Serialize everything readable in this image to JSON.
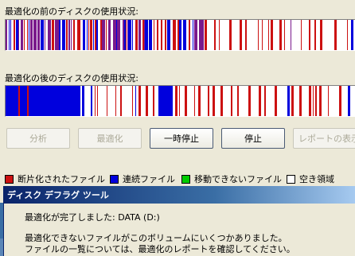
{
  "analysis": {
    "before_label": "最適化の前のディスクの使用状況:",
    "after_label": "最適化の後のディスクの使用状況:"
  },
  "colors": {
    "fragmented": "#cc1111",
    "contiguous": "#0000dd",
    "unmovable": "#00cc00",
    "free": "#ffffff",
    "purple": "#7a1a8c"
  },
  "buttons": {
    "analyze": "分析",
    "defragment": "最適化",
    "pause": "一時停止",
    "stop": "停止",
    "view_report": "レポートの表示"
  },
  "legend": {
    "fragmented": "断片化されたファイル",
    "contiguous": "連続ファイル",
    "unmovable": "移動できないファイル",
    "free": "空き領域"
  },
  "dialog": {
    "title": "ディスク デフラグ ツール",
    "message": "最適化が完了しました: DATA (D:)",
    "note_line1": "最適化できないファイルがこのボリュームにいくつかありました。",
    "note_line2": "ファイルの一覧については、最適化のレポートを確認してください。"
  }
}
